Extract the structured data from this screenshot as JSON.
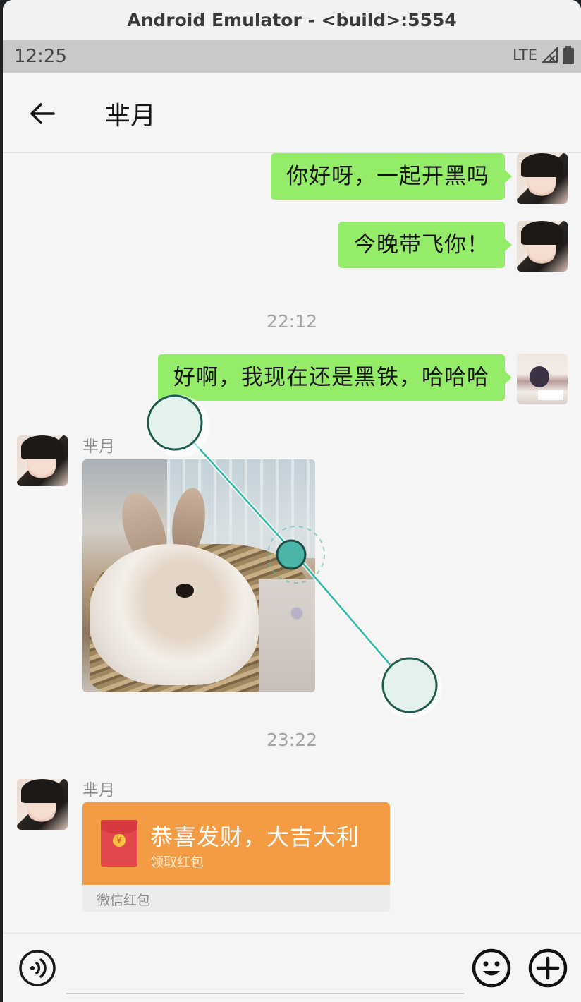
{
  "window": {
    "title": "Android Emulator - <build>:5554"
  },
  "status_bar": {
    "time": "12:25",
    "network": "LTE",
    "icons": [
      "signal-icon",
      "battery-icon"
    ]
  },
  "app_bar": {
    "title": "芈月",
    "back_icon": "arrow-left-icon"
  },
  "chat": {
    "messages": [
      {
        "side": "right",
        "type": "text",
        "text": "你好呀，一起开黑吗"
      },
      {
        "side": "right",
        "type": "text",
        "text": "今晚带飞你！"
      },
      {
        "type": "timestamp",
        "text": "22:12"
      },
      {
        "side": "right",
        "type": "text",
        "text": "好啊，我现在还是黑铁，哈哈哈"
      },
      {
        "side": "left",
        "type": "image",
        "sender": "芈月"
      },
      {
        "type": "timestamp",
        "text": "23:22"
      },
      {
        "side": "left",
        "type": "red_packet",
        "sender": "芈月",
        "title": "恭喜发财，大吉大利",
        "subtitle": "领取红包",
        "footer": "微信红包",
        "coin_symbol": "¥"
      }
    ]
  },
  "input_bar": {
    "voice_icon": "voice-icon",
    "emoji_icon": "emoji-icon",
    "plus_icon": "plus-circle-icon"
  },
  "colors": {
    "bubble_green": "#95ec69",
    "red_packet": "#f39c43",
    "gesture_teal": "#2fb8a8"
  }
}
